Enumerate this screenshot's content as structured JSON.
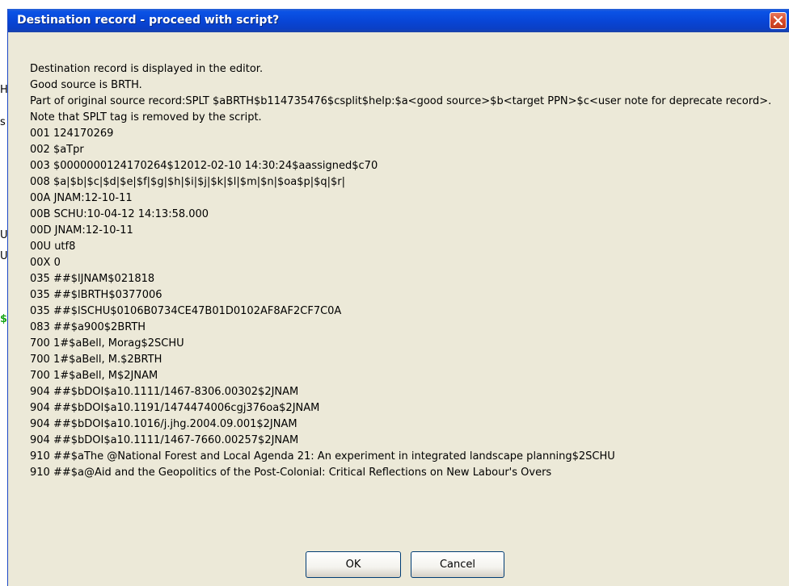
{
  "background": {
    "fragments": [
      "H",
      "s",
      "U",
      "U",
      "$"
    ]
  },
  "dialog": {
    "title": "Destination record - proceed with script?",
    "close_label": "X",
    "message_lines": [
      "Destination record is displayed in the editor.",
      "Good source is BRTH.",
      "Part of original source record:SPLT $aBRTH$b114735476$csplit$help:$a<good source>$b<target PPN>$c<user note for deprecate record>. Note that SPLT tag is removed by the script.",
      "001 124170269",
      "002 $aTpr",
      "003 $0000000124170264$12012-02-10 14:30:24$aassigned$c70",
      "008 $a|$b|$c|$d|$e|$f|$g|$h|$i|$j|$k|$l|$m|$n|$oa$p|$q|$r|",
      "00A JNAM:12-10-11",
      "00B SCHU:10-04-12 14:13:58.000",
      "00D JNAM:12-10-11",
      "00U utf8",
      "00X 0",
      "035 ##$lJNAM$021818",
      "035 ##$lBRTH$0377006",
      "035 ##$lSCHU$0106B0734CE47B01D0102AF8AF2CF7C0A",
      "083 ##$a900$2BRTH",
      "700 1#$aBell, Morag$2SCHU",
      "700 1#$aBell, M.$2BRTH",
      "700 1#$aBell, M$2JNAM",
      "904 ##$bDOI$a10.1111/1467-8306.00302$2JNAM",
      "904 ##$bDOI$a10.1191/1474474006cgj376oa$2JNAM",
      "904 ##$bDOI$a10.1016/j.jhg.2004.09.001$2JNAM",
      "904 ##$bDOI$a10.1111/1467-7660.00257$2JNAM",
      "910 ##$aThe @National Forest and Local Agenda 21: An experiment in integrated landscape planning$2SCHU",
      "910 ##$a@Aid and the Geopolitics of the Post-Colonial: Critical Reflections on New Labour's Overs"
    ],
    "buttons": {
      "ok": "OK",
      "cancel": "Cancel"
    }
  },
  "colors": {
    "titlebar": "#0845d5",
    "dialog_bg": "#ece9d8",
    "close_btn": "#d64b2b"
  }
}
